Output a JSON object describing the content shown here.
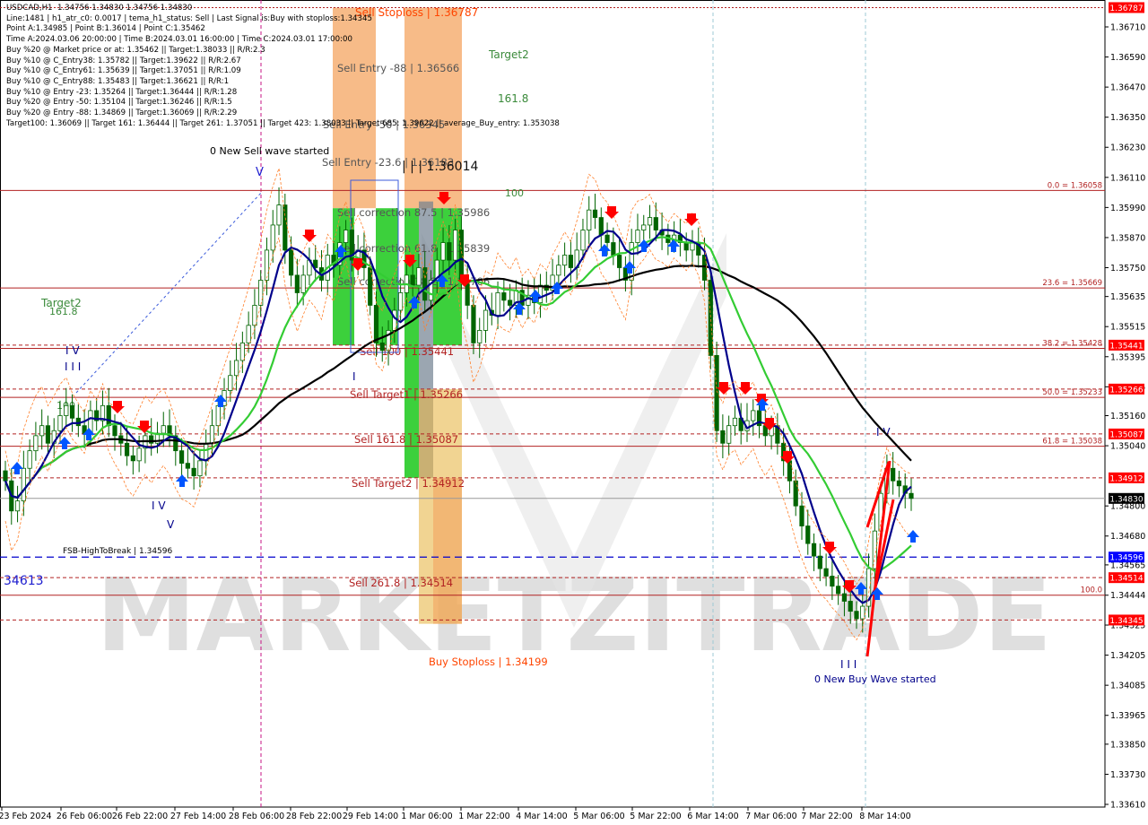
{
  "header": {
    "symbol_line": "USDCAD,H1  1.34756 1.34830 1.34756 1.34830",
    "info_lines": [
      "Line:1481 | h1_atr_c0: 0.0017 | tema_h1_status: Sell | Last Signal is:Buy with stoploss:1.34345",
      "Point A:1.34985 | Point B:1.36014 | Point C:1.35462",
      "Time A:2024.03.06 20:00:00 | Time B:2024.03.01 16:00:00 | Time C:2024.03.01 17:00:00",
      "Buy %20 @ Market price or at: 1.35462 || Target:1.38033 || R/R:2.3",
      "Buy %10 @ C_Entry38: 1.35782 || Target:1.39622 || R/R:2.67",
      "Buy %10 @ C_Entry61: 1.35639 || Target:1.37051 || R/R:1.09",
      "Buy %10 @ C_Entry88: 1.35483 || Target:1.36621 || R/R:1",
      "Buy %10 @ Entry -23: 1.35264 || Target:1.36444 || R/R:1.28",
      "Buy %20 @ Entry -50: 1.35104 || Target:1.36246 || R/R:1.5",
      "Buy %20 @ Entry -88: 1.34869 || Target:1.36069 || R/R:2.29",
      "Target100: 1.36069 || Target 161: 1.36444 || Target 261: 1.37051 || Target 423: 1.38033 || Target 685: 1.39622 || average_Buy_entry: 1.353038"
    ]
  },
  "colors": {
    "background": "#ffffff",
    "bull_candle": "#006400",
    "bear_candle": "#006400",
    "level_line": "#b22222",
    "ma_blue": "#00008b",
    "ma_green": "#33cc33",
    "ma_black": "#000000",
    "buy_zone": "#32cd32",
    "sell_zone": "#f4a460",
    "gray_zone": "#708090",
    "label_red_bg": "#ff0000",
    "current_price_bg": "#000000",
    "fsb_line": "#0000cd",
    "arrow_up": "#0055ff",
    "arrow_down": "#ff0000"
  },
  "chart_data": {
    "type": "candlestick",
    "title": "USDCAD,H1",
    "ylim": [
      1.3361,
      1.368
    ],
    "x_tick_labels": [
      "23 Feb 2024",
      "26 Feb 06:00",
      "26 Feb 22:00",
      "27 Feb 14:00",
      "28 Feb 06:00",
      "28 Feb 22:00",
      "29 Feb 14:00",
      "1 Mar 06:00",
      "1 Mar 22:00",
      "4 Mar 14:00",
      "5 Mar 06:00",
      "5 Mar 22:00",
      "6 Mar 14:00",
      "7 Mar 06:00",
      "7 Mar 22:00",
      "8 Mar 14:00"
    ],
    "y_tick_labels": [
      "1.36710",
      "1.36590",
      "1.36470",
      "1.36350",
      "1.36230",
      "1.36110",
      "1.35990",
      "1.35870",
      "1.35750",
      "1.35635",
      "1.35515",
      "1.35395",
      "1.35275",
      "1.35160",
      "1.35040",
      "1.34800",
      "1.34680",
      "1.34565",
      "1.34444",
      "1.34325",
      "1.34205",
      "1.34085",
      "1.33965",
      "1.33850",
      "1.33730",
      "1.33610"
    ],
    "y_tick_values": [
      1.3671,
      1.3659,
      1.3647,
      1.3635,
      1.3623,
      1.3611,
      1.3599,
      1.3587,
      1.3575,
      1.35635,
      1.35515,
      1.35395,
      1.35275,
      1.3516,
      1.3504,
      1.348,
      1.3468,
      1.34565,
      1.34444,
      1.34325,
      1.34205,
      1.34085,
      1.33965,
      1.3385,
      1.3373,
      1.3361
    ],
    "price_tags": [
      {
        "label": "1.36787",
        "value": 1.36787,
        "color": "#ff0000"
      },
      {
        "label": "1.35441",
        "value": 1.35441,
        "color": "#ff0000"
      },
      {
        "label": "1.35266",
        "value": 1.35266,
        "color": "#ff0000"
      },
      {
        "label": "1.35087",
        "value": 1.35087,
        "color": "#ff0000"
      },
      {
        "label": "1.34912",
        "value": 1.34912,
        "color": "#ff0000"
      },
      {
        "label": "1.34830",
        "value": 1.3483,
        "color": "#000000"
      },
      {
        "label": "1.34596",
        "value": 1.34596,
        "color": "#0000ff"
      },
      {
        "label": "1.34514",
        "value": 1.34514,
        "color": "#ff0000"
      },
      {
        "label": "1.34345",
        "value": 1.34345,
        "color": "#ff0000"
      }
    ],
    "levels": [
      {
        "value": 1.36787,
        "style": "dotted",
        "color": "#b22222"
      },
      {
        "value": 1.36058,
        "style": "solid",
        "color": "#b22222",
        "label": "0.0 = 1.36058"
      },
      {
        "value": 1.35669,
        "style": "solid",
        "color": "#b22222",
        "label": "23.6 = 1.35669"
      },
      {
        "value": 1.35441,
        "style": "dashed",
        "color": "#b22222"
      },
      {
        "value": 1.35428,
        "style": "solid",
        "color": "#b22222",
        "label": "38.2 = 1.35428"
      },
      {
        "value": 1.35266,
        "style": "dashed",
        "color": "#b22222"
      },
      {
        "value": 1.35233,
        "style": "solid",
        "color": "#b22222",
        "label": "50.0 = 1.35233"
      },
      {
        "value": 1.35087,
        "style": "dashed",
        "color": "#b22222"
      },
      {
        "value": 1.35038,
        "style": "solid",
        "color": "#b22222",
        "label": "61.8 = 1.35038"
      },
      {
        "value": 1.34912,
        "style": "dashed",
        "color": "#b22222"
      },
      {
        "value": 1.3483,
        "style": "solid",
        "color": "#999999"
      },
      {
        "value": 1.34514,
        "style": "dashed",
        "color": "#b22222"
      },
      {
        "value": 1.34444,
        "style": "solid",
        "color": "#b22222",
        "label": "100.0"
      },
      {
        "value": 1.34345,
        "style": "dashed",
        "color": "#b22222"
      }
    ],
    "fsb_line": {
      "value": 1.34596,
      "label": "FSB-HighToBreak | 1.34596",
      "left_label": "34613"
    },
    "zone_labels": [
      {
        "text": "Sell Stoploss | 1.36787",
        "value": 1.36787,
        "color": "#ff4500"
      },
      {
        "text": "Sell Entry -88 | 1.36566",
        "value": 1.36566,
        "color": "#555555"
      },
      {
        "text": "Sell Entry -50 | 1.36345",
        "value": 1.36345,
        "color": "#555555"
      },
      {
        "text": "Sell Entry -23.6 | 1.36183",
        "value": 1.36183,
        "color": "#555555"
      },
      {
        "text": "Sell correction 87.5 | 1.35986",
        "value": 1.35986,
        "color": "#555555"
      },
      {
        "text": "Sell correction 61.8 | 1.35839",
        "value": 1.35839,
        "color": "#555555"
      },
      {
        "text": "Sell correction 38.2 | 1.35706",
        "value": 1.35706,
        "color": "#555555"
      },
      {
        "text": "Sell 100 | 1.35441",
        "value": 1.35441,
        "color": "#b22222"
      },
      {
        "text": "Sell Target1 | 1.35266",
        "value": 1.35266,
        "color": "#b22222"
      },
      {
        "text": "Sell 161.8 | 1.35087",
        "value": 1.35087,
        "color": "#b22222"
      },
      {
        "text": "Sell Target2 | 1.34912",
        "value": 1.34912,
        "color": "#b22222"
      },
      {
        "text": "Sell 261.8 | 1.34514",
        "value": 1.34514,
        "color": "#b22222"
      },
      {
        "text": "Buy Stoploss | 1.34199",
        "value": 1.34199,
        "color": "#ff4500"
      }
    ],
    "annotations": {
      "i_1_36014": "| | | 1.36014",
      "new_sell_wave": "0 New Sell wave started",
      "new_buy_wave": "0 New Buy Wave started",
      "target2_top": "Target2",
      "n161_top": "161.8",
      "n100_top": "100",
      "target2_left": "Target2",
      "n161_left": "161.8",
      "n100_left": "100",
      "wave_iv_left": "I V",
      "wave_iii": "I I I",
      "wave_iv_mid": "I V",
      "wave_v": "V",
      "wave_iv_right": "I V",
      "wave_iii_bottom": "I I I",
      "wave_i": "I",
      "wave_v_top": "V"
    },
    "series_close": [
      1.349,
      1.3478,
      1.3482,
      1.3495,
      1.3502,
      1.3508,
      1.3512,
      1.3505,
      1.351,
      1.3516,
      1.352,
      1.3515,
      1.3512,
      1.3509,
      1.3518,
      1.3514,
      1.352,
      1.3512,
      1.3508,
      1.3505,
      1.35,
      1.3498,
      1.3503,
      1.3508,
      1.3505,
      1.3509,
      1.3512,
      1.3508,
      1.3502,
      1.3497,
      1.3495,
      1.3492,
      1.3498,
      1.3505,
      1.3512,
      1.352,
      1.3526,
      1.3532,
      1.3538,
      1.3545,
      1.3552,
      1.356,
      1.357,
      1.3582,
      1.3592,
      1.36,
      1.3582,
      1.3572,
      1.3565,
      1.3572,
      1.3578,
      1.3575,
      1.357,
      1.358,
      1.3576,
      1.3585,
      1.359,
      1.3578,
      1.3582,
      1.3575,
      1.356,
      1.3545,
      1.3542,
      1.355,
      1.3558,
      1.3565,
      1.3572,
      1.3568,
      1.3575,
      1.3562,
      1.357,
      1.3578,
      1.3585,
      1.3578,
      1.359,
      1.357,
      1.356,
      1.3545,
      1.355,
      1.3558,
      1.3556,
      1.3565,
      1.3562,
      1.356,
      1.3566,
      1.356,
      1.3564,
      1.3561,
      1.3568,
      1.3566,
      1.3572,
      1.3576,
      1.358,
      1.3575,
      1.3582,
      1.359,
      1.3598,
      1.3595,
      1.3588,
      1.3585,
      1.358,
      1.3575,
      1.357,
      1.3585,
      1.359,
      1.3592,
      1.3595,
      1.359,
      1.3588,
      1.3585,
      1.3588,
      1.3585,
      1.3582,
      1.3585,
      1.358,
      1.357,
      1.354,
      1.351,
      1.3505,
      1.3512,
      1.3515,
      1.351,
      1.3514,
      1.3518,
      1.3512,
      1.3508,
      1.3512,
      1.3505,
      1.3498,
      1.349,
      1.348,
      1.3472,
      1.3465,
      1.346,
      1.3455,
      1.3452,
      1.3448,
      1.3445,
      1.3442,
      1.3438,
      1.3435,
      1.344,
      1.3455,
      1.347,
      1.3485,
      1.3495,
      1.349,
      1.3488,
      1.3485,
      1.3483
    ]
  }
}
